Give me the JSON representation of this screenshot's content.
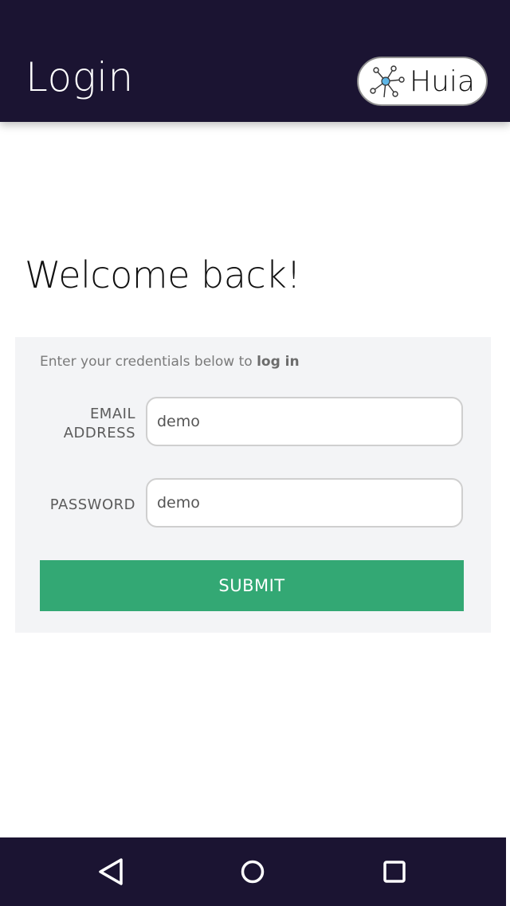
{
  "app_bar": {
    "title": "Login",
    "brand": {
      "name": "Huia",
      "icon": "network-logo-icon"
    }
  },
  "main": {
    "heading": "Welcome back!",
    "form": {
      "instructions_prefix": "Enter your credentials below to ",
      "instructions_emphasis": "log in",
      "email": {
        "label_line1": "EMAIL",
        "label_line2": "ADDRESS",
        "value": "demo"
      },
      "password": {
        "label": "PASSWORD",
        "value": "demo"
      },
      "submit_label": "SUBMIT"
    }
  },
  "system_nav": {
    "back_icon": "back-triangle-icon",
    "home_icon": "home-circle-icon",
    "recents_icon": "recents-square-icon"
  },
  "colors": {
    "app_bar": "#1b1432",
    "submit": "#33a874",
    "card_bg": "#f3f4f6",
    "logo_accent": "#5eb6e6"
  }
}
